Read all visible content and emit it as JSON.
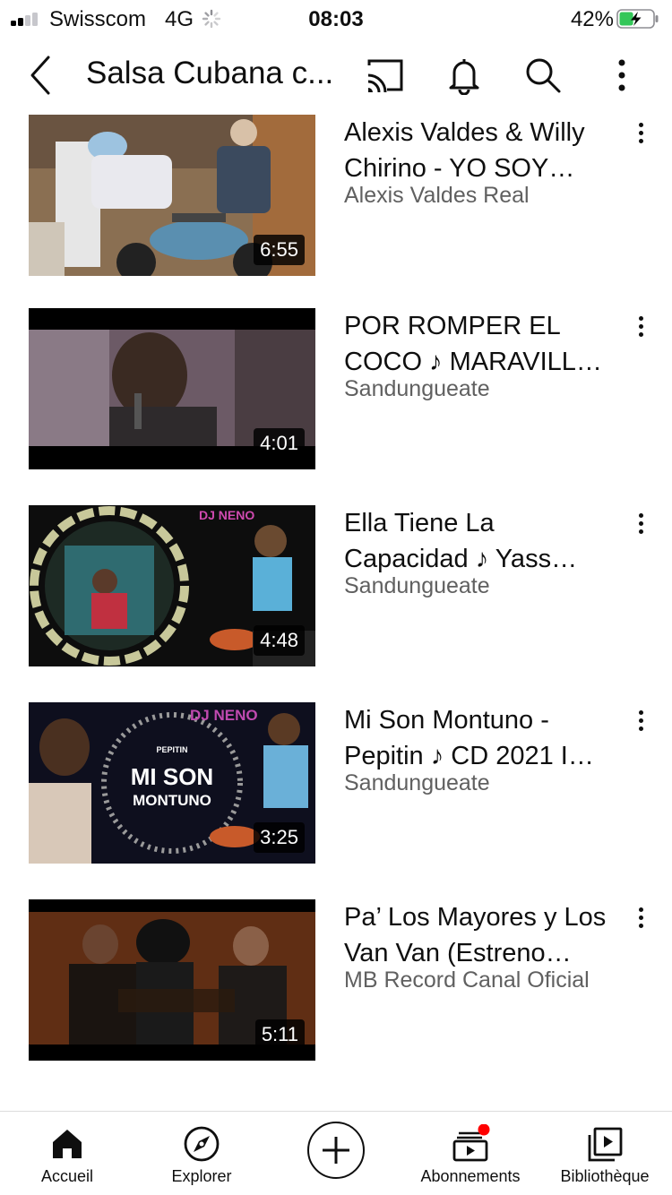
{
  "status_bar": {
    "carrier": "Swisscom",
    "network": "4G",
    "time": "08:03",
    "battery_percent": "42%",
    "battery_level": 0.42
  },
  "header": {
    "title": "Salsa Cubana c...",
    "back_icon": "chevron-left-icon",
    "cast_icon": "cast-icon",
    "notifications_icon": "bell-icon",
    "search_icon": "search-icon",
    "more_icon": "more-vertical-icon"
  },
  "videos": [
    {
      "title": "Alexis Valdes & Willy Chirino - YO SOY…",
      "channel": "Alexis Valdes Real",
      "duration": "6:55"
    },
    {
      "title": "POR ROMPER EL COCO ♪ MARAVILL…",
      "channel": "Sandungueate",
      "duration": "4:01"
    },
    {
      "title": "Ella Tiene La Capacidad ♪ Yass…",
      "channel": "Sandungueate",
      "duration": "4:48",
      "thumb_text": "DJ NENO"
    },
    {
      "title": "Mi Son Montuno - Pepitin ♪ CD 2021 I…",
      "channel": "Sandungueate",
      "duration": "3:25",
      "thumb_text": [
        "DJ NENO",
        "PEPITIN",
        "MI SON",
        "MONTUNO"
      ]
    },
    {
      "title": "Pa’ Los Mayores y Los Van Van (Estreno…",
      "channel": "MB Record Canal Oficial",
      "duration": "5:11"
    }
  ],
  "bottom_nav": {
    "items": [
      {
        "label": "Accueil",
        "icon": "home-icon"
      },
      {
        "label": "Explorer",
        "icon": "compass-icon"
      },
      {
        "label": "",
        "icon": "add-icon"
      },
      {
        "label": "Abonnements",
        "icon": "subscriptions-icon"
      },
      {
        "label": "Bibliothèque",
        "icon": "library-icon"
      }
    ]
  },
  "colors": {
    "text_primary": "#0f0f0f",
    "text_secondary": "#606060",
    "notification_dot": "#ff0000",
    "battery_fill": "#34c759"
  }
}
